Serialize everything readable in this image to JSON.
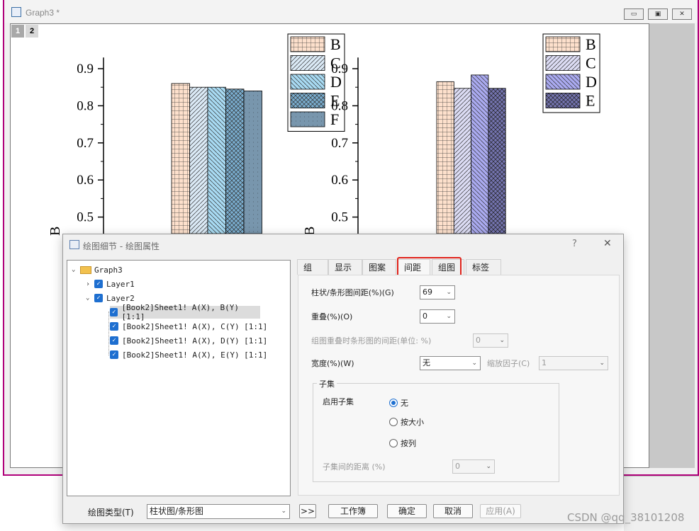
{
  "graph_window": {
    "title": "Graph3 *",
    "pages": [
      "1",
      "2"
    ],
    "controls": {
      "minimize": "▭",
      "restore": "▣",
      "close": "✕"
    }
  },
  "chart_data": [
    {
      "type": "bar",
      "categories": [
        ""
      ],
      "series": [
        {
          "name": "B",
          "values": [
            0.86
          ]
        },
        {
          "name": "C",
          "values": [
            0.85
          ]
        },
        {
          "name": "D",
          "values": [
            0.85
          ]
        },
        {
          "name": "E",
          "values": [
            0.845
          ]
        },
        {
          "name": "F",
          "values": [
            0.84
          ]
        }
      ],
      "yticks": [
        "0.9",
        "0.8",
        "0.7",
        "0.6",
        "0.5"
      ],
      "ylim": [
        0.44,
        0.93
      ],
      "legend_position": "top-right",
      "ylabel": "B"
    },
    {
      "type": "bar",
      "categories": [
        ""
      ],
      "series": [
        {
          "name": "B",
          "values": [
            0.865
          ]
        },
        {
          "name": "C",
          "values": [
            0.847
          ]
        },
        {
          "name": "D",
          "values": [
            0.883
          ]
        },
        {
          "name": "E",
          "values": [
            0.847
          ]
        }
      ],
      "yticks": [
        "0.9",
        "0.8",
        "0.7",
        "0.6",
        "0.5"
      ],
      "ylim": [
        0.44,
        0.93
      ],
      "legend_position": "top-right",
      "ylabel": "B"
    }
  ],
  "dialog": {
    "title": "绘图细节 - 绘图属性",
    "help": "?",
    "close": "✕",
    "tree": {
      "root": "Graph3",
      "layers": [
        "Layer1",
        "Layer2"
      ],
      "plots": [
        "[Book2]Sheet1! A(X), B(Y) [1:1]",
        "[Book2]Sheet1! A(X), C(Y) [1:1]",
        "[Book2]Sheet1! A(X), D(Y) [1:1]",
        "[Book2]Sheet1! A(X), E(Y) [1:1]"
      ]
    },
    "tabs": [
      "组",
      "显示",
      "图案",
      "间距",
      "组图",
      "标签"
    ],
    "active_tab": "间距",
    "fields": {
      "gap_label": "柱状/条形图间距(%)(G)",
      "gap_value": "69",
      "overlap_label": "重叠(%)(O)",
      "overlap_value": "0",
      "group_gap_label": "组图重叠时条形图的间距(单位: %)",
      "group_gap_value": "0",
      "width_label": "宽度(%)(W)",
      "width_value": "无",
      "scale_label": "缩放因子(C)",
      "scale_value": "1"
    },
    "subset": {
      "group_title": "子集",
      "enable_label": "启用子集",
      "options": [
        "无",
        "按大小",
        "按列"
      ],
      "selected": "无",
      "distance_label": "子集间的距离 (%)",
      "distance_value": "0"
    },
    "bottom": {
      "plot_type_label": "绘图类型(T)",
      "plot_type_value": "柱状图/条形图",
      "more": ">>",
      "workbook": "工作簿",
      "ok": "确定",
      "cancel": "取消",
      "apply": "应用(A)"
    }
  },
  "watermark": "CSDN @qq_38101208",
  "colors": {
    "highlight": "#e0231b",
    "accent": "#1e6fd0",
    "window_border": "#b0007a"
  }
}
